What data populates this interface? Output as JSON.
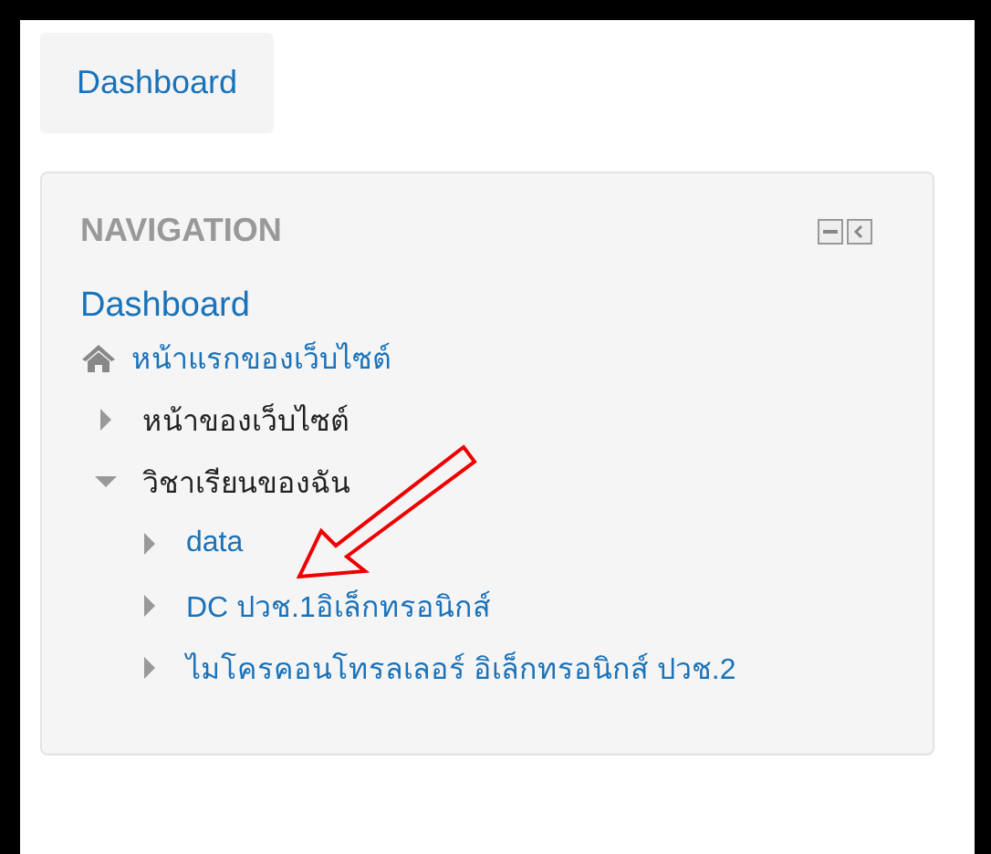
{
  "top_button": "Dashboard",
  "navigation": {
    "title": "NAVIGATION",
    "root_link": "Dashboard",
    "items": [
      {
        "kind": "home",
        "label": "หน้าแรกของเว็บไซต์",
        "link": true
      },
      {
        "kind": "branch",
        "label": "หน้าของเว็บไซต์",
        "link": false,
        "expanded": false
      },
      {
        "kind": "branch",
        "label": "วิชาเรียนของฉัน",
        "link": false,
        "expanded": true,
        "children": [
          {
            "kind": "branch",
            "label": "data",
            "link": true,
            "expanded": false
          },
          {
            "kind": "branch",
            "label": "DC ปวช.1อิเล็กทรอนิกส์",
            "link": true,
            "expanded": false
          },
          {
            "kind": "branch",
            "label": "ไมโครคอนโทรลเลอร์ อิเล็กทรอนิกส์ ปวช.2",
            "link": true,
            "expanded": false
          }
        ]
      }
    ]
  }
}
